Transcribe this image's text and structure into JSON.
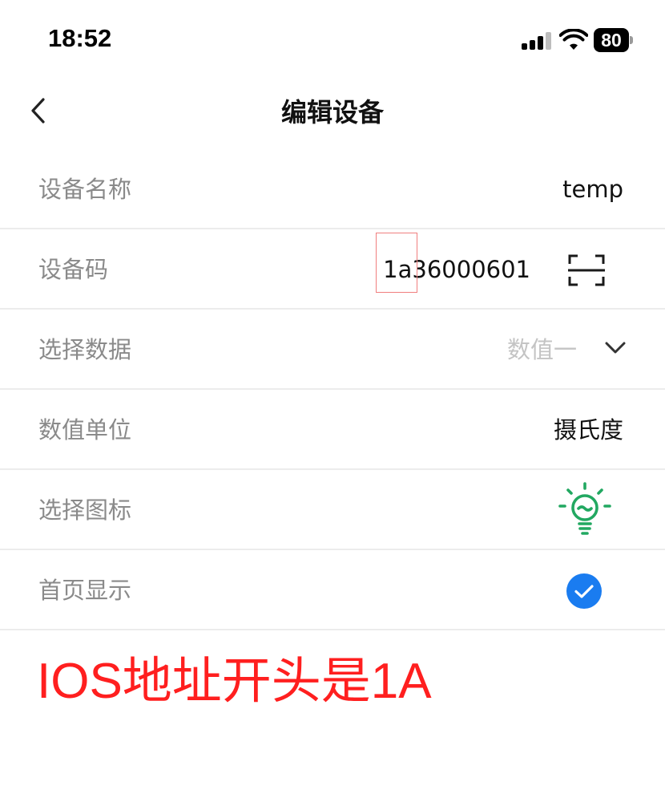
{
  "status_bar": {
    "time": "18:52",
    "battery_level": "80",
    "signal_icon": "cellular-signal-icon",
    "wifi_icon": "wifi-icon",
    "battery_icon": "battery-icon"
  },
  "nav": {
    "title": "编辑设备",
    "back_icon": "chevron-left-icon"
  },
  "form": {
    "device_name": {
      "label": "设备名称",
      "value": "temp"
    },
    "device_code": {
      "label": "设备码",
      "value": "1a36000601",
      "action_icon": "scan-icon"
    },
    "data_select": {
      "label": "选择数据",
      "placeholder": "数值一",
      "icon": "chevron-down-icon"
    },
    "unit": {
      "label": "数值单位",
      "value": "摄氏度"
    },
    "icon_select": {
      "label": "选择图标",
      "icon": "lightbulb-icon",
      "icon_color": "#22a861"
    },
    "show_home": {
      "label": "首页显示",
      "checked": true,
      "icon": "checkmark-circle-icon",
      "icon_color": "#1a7cf0"
    }
  },
  "annotation": {
    "text": "IOS地址开头是1A",
    "color": "#ff1f1f"
  },
  "colors": {
    "label": "#8a8a8a",
    "value": "#111111",
    "placeholder": "#c4c4c4",
    "divider": "#ececec",
    "highlight_box": "#f07f7f"
  }
}
